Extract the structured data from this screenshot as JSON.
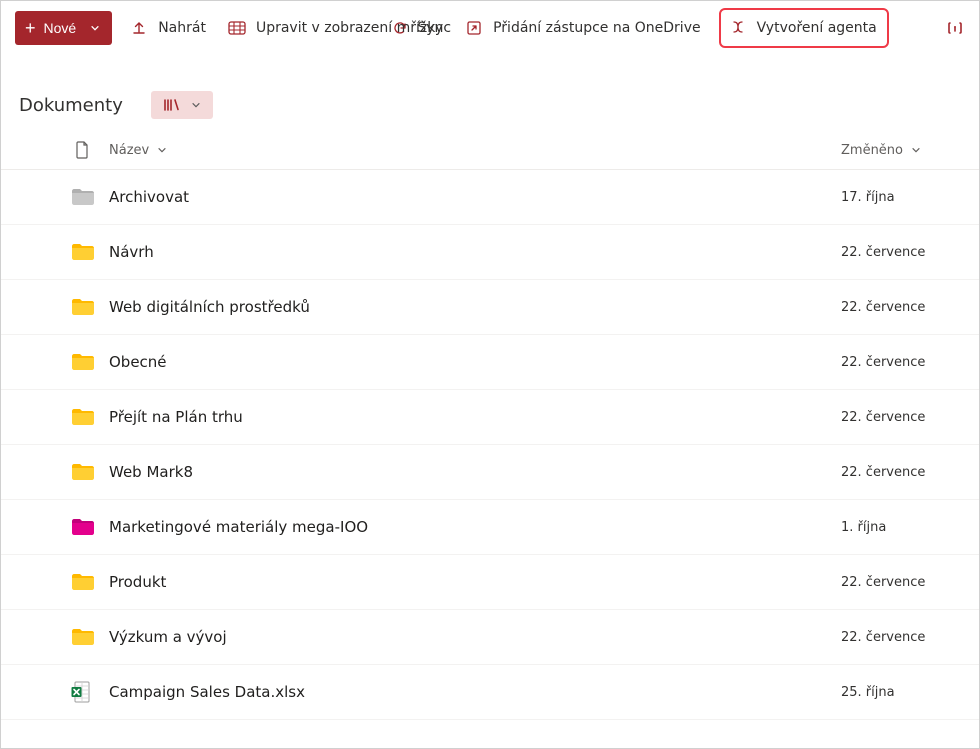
{
  "toolbar": {
    "new_label": "Nové",
    "upload_label": "Nahrát",
    "edit_grid_label": "Upravit v zobrazení mřížky",
    "sync_label": "Sync",
    "add_shortcut_label": "Přidání zástupce na OneDrive",
    "create_agent_label": "Vytvoření agenta"
  },
  "library": {
    "title": "Dokumenty"
  },
  "columns": {
    "name": "Název",
    "modified": "Změněno"
  },
  "items": [
    {
      "type": "folder-grey",
      "name": "Archivovat",
      "modified": "17. října"
    },
    {
      "type": "folder-yellow",
      "name": "Návrh",
      "modified": "22. července"
    },
    {
      "type": "folder-yellow",
      "name": "Web digitálních prostředků",
      "modified": "22. července"
    },
    {
      "type": "folder-yellow",
      "name": "Obecné",
      "modified": "22. července"
    },
    {
      "type": "folder-yellow",
      "name": "Přejít na Plán trhu",
      "modified": "22. července"
    },
    {
      "type": "folder-yellow",
      "name": "Web Mark8",
      "modified": "22. července"
    },
    {
      "type": "folder-pink",
      "name": "Marketingové materiály mega-IOO",
      "modified": "1. října"
    },
    {
      "type": "folder-yellow",
      "name": "Produkt",
      "modified": "22. července"
    },
    {
      "type": "folder-yellow",
      "name": "Výzkum a vývoj",
      "modified": "22. července"
    },
    {
      "type": "excel",
      "name": "Campaign Sales Data.xlsx",
      "modified": "25. října"
    }
  ],
  "colors": {
    "accent": "#a4262c",
    "highlight": "#ef3a47",
    "folder_yellow_a": "#ffcf33",
    "folder_yellow_b": "#ffb900",
    "folder_grey_a": "#c8c8c8",
    "folder_grey_b": "#b0b0b0",
    "folder_pink_a": "#e3008c",
    "folder_pink_b": "#c2007a",
    "excel_green": "#107c41"
  }
}
